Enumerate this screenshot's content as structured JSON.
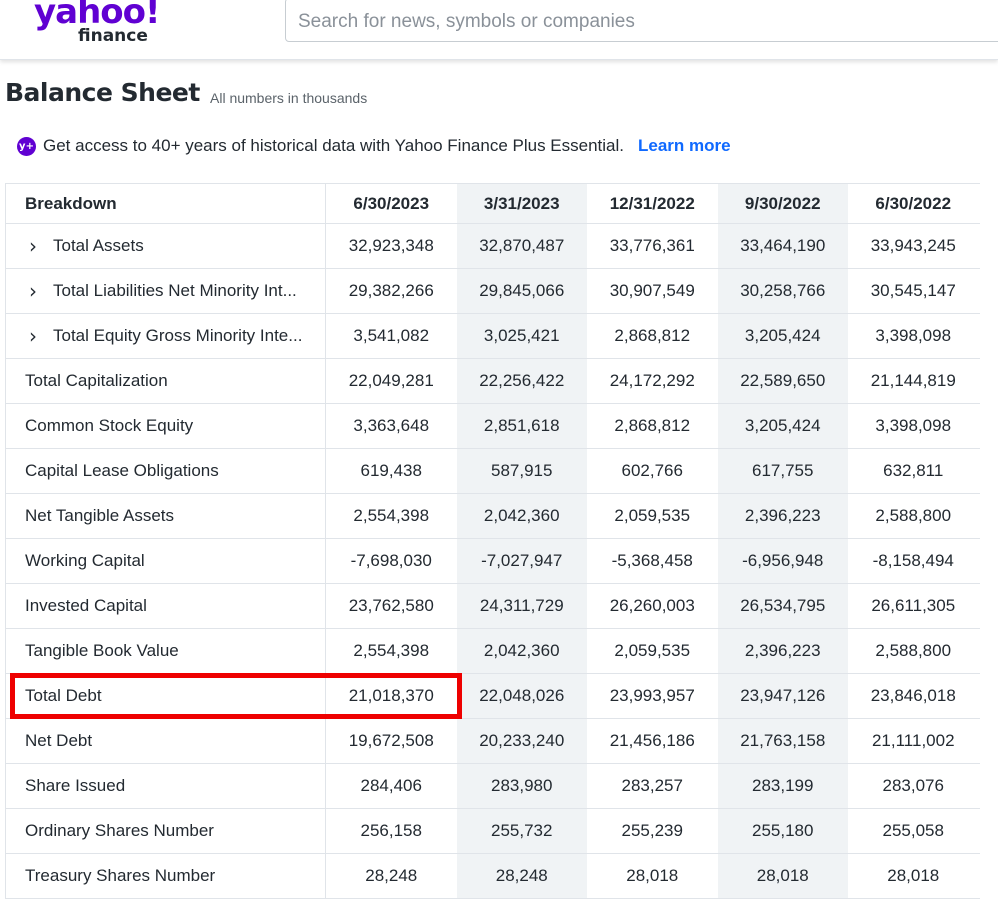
{
  "header": {
    "logo_main": "yahoo!",
    "logo_sub": "finance",
    "search_placeholder": "Search for news, symbols or companies"
  },
  "page": {
    "title": "Balance Sheet",
    "subtitle": "All numbers in thousands"
  },
  "promo": {
    "icon_text": "y+",
    "text": "Get access to 40+ years of historical data with Yahoo Finance Plus Essential.",
    "link": "Learn more"
  },
  "table": {
    "breakdown_label": "Breakdown",
    "columns": [
      "6/30/2023",
      "3/31/2023",
      "12/31/2022",
      "9/30/2022",
      "6/30/2022"
    ],
    "rows": [
      {
        "label": "Total Assets",
        "expandable": true,
        "values": [
          "32,923,348",
          "32,870,487",
          "33,776,361",
          "33,464,190",
          "33,943,245"
        ]
      },
      {
        "label": "Total Liabilities Net Minority Int...",
        "expandable": true,
        "values": [
          "29,382,266",
          "29,845,066",
          "30,907,549",
          "30,258,766",
          "30,545,147"
        ]
      },
      {
        "label": "Total Equity Gross Minority Inte...",
        "expandable": true,
        "values": [
          "3,541,082",
          "3,025,421",
          "2,868,812",
          "3,205,424",
          "3,398,098"
        ]
      },
      {
        "label": "Total Capitalization",
        "expandable": false,
        "values": [
          "22,049,281",
          "22,256,422",
          "24,172,292",
          "22,589,650",
          "21,144,819"
        ]
      },
      {
        "label": "Common Stock Equity",
        "expandable": false,
        "values": [
          "3,363,648",
          "2,851,618",
          "2,868,812",
          "3,205,424",
          "3,398,098"
        ]
      },
      {
        "label": "Capital Lease Obligations",
        "expandable": false,
        "values": [
          "619,438",
          "587,915",
          "602,766",
          "617,755",
          "632,811"
        ]
      },
      {
        "label": "Net Tangible Assets",
        "expandable": false,
        "values": [
          "2,554,398",
          "2,042,360",
          "2,059,535",
          "2,396,223",
          "2,588,800"
        ]
      },
      {
        "label": "Working Capital",
        "expandable": false,
        "values": [
          "-7,698,030",
          "-7,027,947",
          "-5,368,458",
          "-6,956,948",
          "-8,158,494"
        ]
      },
      {
        "label": "Invested Capital",
        "expandable": false,
        "values": [
          "23,762,580",
          "24,311,729",
          "26,260,003",
          "26,534,795",
          "26,611,305"
        ]
      },
      {
        "label": "Tangible Book Value",
        "expandable": false,
        "values": [
          "2,554,398",
          "2,042,360",
          "2,059,535",
          "2,396,223",
          "2,588,800"
        ]
      },
      {
        "label": "Total Debt",
        "expandable": false,
        "values": [
          "21,018,370",
          "22,048,026",
          "23,993,957",
          "23,947,126",
          "23,846,018"
        ]
      },
      {
        "label": "Net Debt",
        "expandable": false,
        "values": [
          "19,672,508",
          "20,233,240",
          "21,456,186",
          "21,763,158",
          "21,111,002"
        ]
      },
      {
        "label": "Share Issued",
        "expandable": false,
        "values": [
          "284,406",
          "283,980",
          "283,257",
          "283,199",
          "283,076"
        ]
      },
      {
        "label": "Ordinary Shares Number",
        "expandable": false,
        "values": [
          "256,158",
          "255,732",
          "255,239",
          "255,180",
          "255,058"
        ]
      },
      {
        "label": "Treasury Shares Number",
        "expandable": false,
        "values": [
          "28,248",
          "28,248",
          "28,018",
          "28,018",
          "28,018"
        ]
      }
    ]
  },
  "colors": {
    "brand": "#6001d2",
    "link": "#0f69ff",
    "highlight": "#ee0000",
    "shaded_column": "#f0f3f5"
  },
  "icons": {
    "expand": "chevron-right-icon"
  }
}
